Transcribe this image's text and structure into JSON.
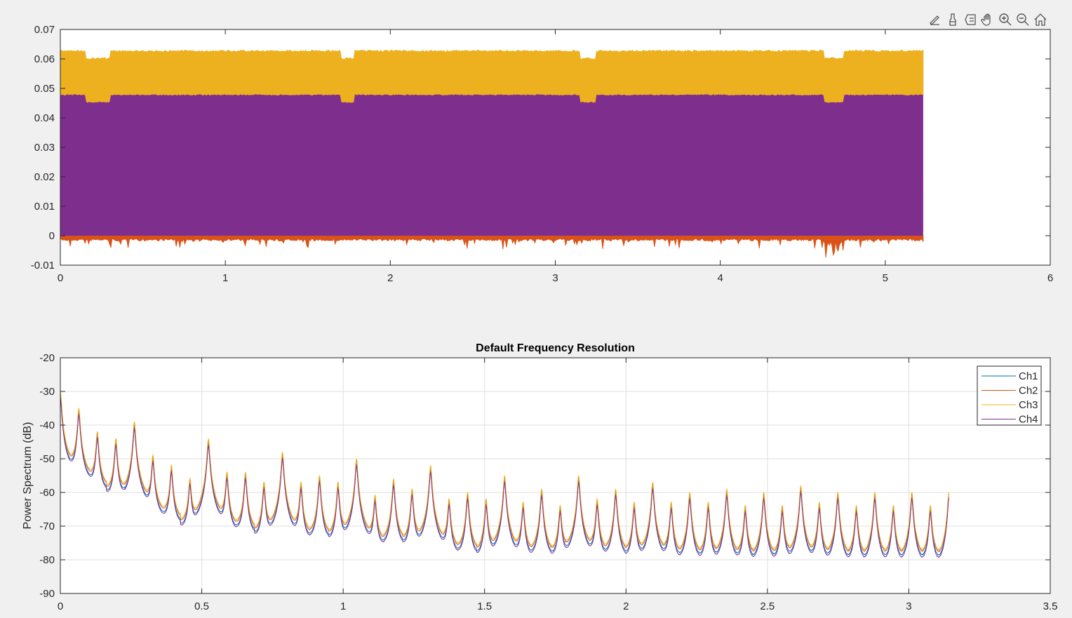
{
  "toolbar": {
    "icons": [
      "brush-edit-icon",
      "data-brush-icon",
      "legend-insert-icon",
      "pan-hand-icon",
      "zoom-in-icon",
      "zoom-out-icon",
      "home-restore-icon"
    ]
  },
  "chart_data": [
    {
      "type": "area",
      "title": "",
      "xlabel": "",
      "ylabel": "",
      "xlim": [
        0,
        6
      ],
      "ylim": [
        -0.01,
        0.07
      ],
      "xticks": [
        "0",
        "1",
        "2",
        "3",
        "4",
        "5",
        "6"
      ],
      "yticks": [
        "-0.01",
        "0",
        "0.01",
        "0.02",
        "0.03",
        "0.04",
        "0.05",
        "0.06",
        "0.07"
      ],
      "grid": false,
      "x_end": 5.23,
      "series": [
        {
          "name": "Ch2",
          "color": "#D95319",
          "min": -0.001,
          "max": 0.0
        },
        {
          "name": "Ch3",
          "color": "#EDB120",
          "min": 0.048,
          "max": 0.063
        },
        {
          "name": "Ch4",
          "color": "#7E2F8E",
          "min": 0.0,
          "max": 0.048
        }
      ],
      "envelope_dips_x": [
        [
          0.15,
          0.3
        ],
        [
          1.7,
          1.78
        ],
        [
          3.15,
          3.25
        ],
        [
          4.63,
          4.75
        ]
      ]
    },
    {
      "type": "line",
      "title": "Default Frequency Resolution",
      "xlabel": "",
      "ylabel": "Power Spectrum (dB)",
      "xlim": [
        0,
        3.5
      ],
      "ylim": [
        -90,
        -20
      ],
      "xticks": [
        "0",
        "0.5",
        "1",
        "1.5",
        "2",
        "2.5",
        "3",
        "3.5"
      ],
      "yticks": [
        "-90",
        "-80",
        "-70",
        "-60",
        "-50",
        "-40",
        "-30",
        "-20"
      ],
      "grid": true,
      "legend": {
        "placement": "top-right",
        "entries": [
          "Ch1",
          "Ch2",
          "Ch3",
          "Ch4"
        ]
      },
      "peak_spacing": 0.06545,
      "x_end": 3.1416,
      "floor_db": {
        "start": -74,
        "end": -80
      },
      "ch3_peaks_db": [
        -30,
        -35,
        -42,
        -44,
        -39,
        -49,
        -52,
        -56,
        -44,
        -54,
        -54,
        -57,
        -48,
        -57,
        -55,
        -57,
        -50,
        -61,
        -56,
        -59,
        -52,
        -62,
        -60,
        -62,
        -55,
        -63,
        -59,
        -64,
        -55,
        -62,
        -59,
        -63,
        -57,
        -63,
        -60,
        -63,
        -59,
        -64,
        -60,
        -64,
        -58,
        -63,
        -60,
        -64,
        -60,
        -64,
        -60,
        -64,
        -60
      ],
      "series": [
        {
          "name": "Ch1",
          "color": "#0072BD",
          "peak_offset_db": -1.5,
          "floor_offset_db": -1.5
        },
        {
          "name": "Ch2",
          "color": "#D95319",
          "peak_offset_db": -0.5,
          "floor_offset_db": 0
        },
        {
          "name": "Ch3",
          "color": "#EDB120",
          "peak_offset_db": 0,
          "floor_offset_db": 0.5
        },
        {
          "name": "Ch4",
          "color": "#7E2F8E",
          "peak_offset_db": -2,
          "floor_offset_db": -3
        }
      ]
    }
  ]
}
